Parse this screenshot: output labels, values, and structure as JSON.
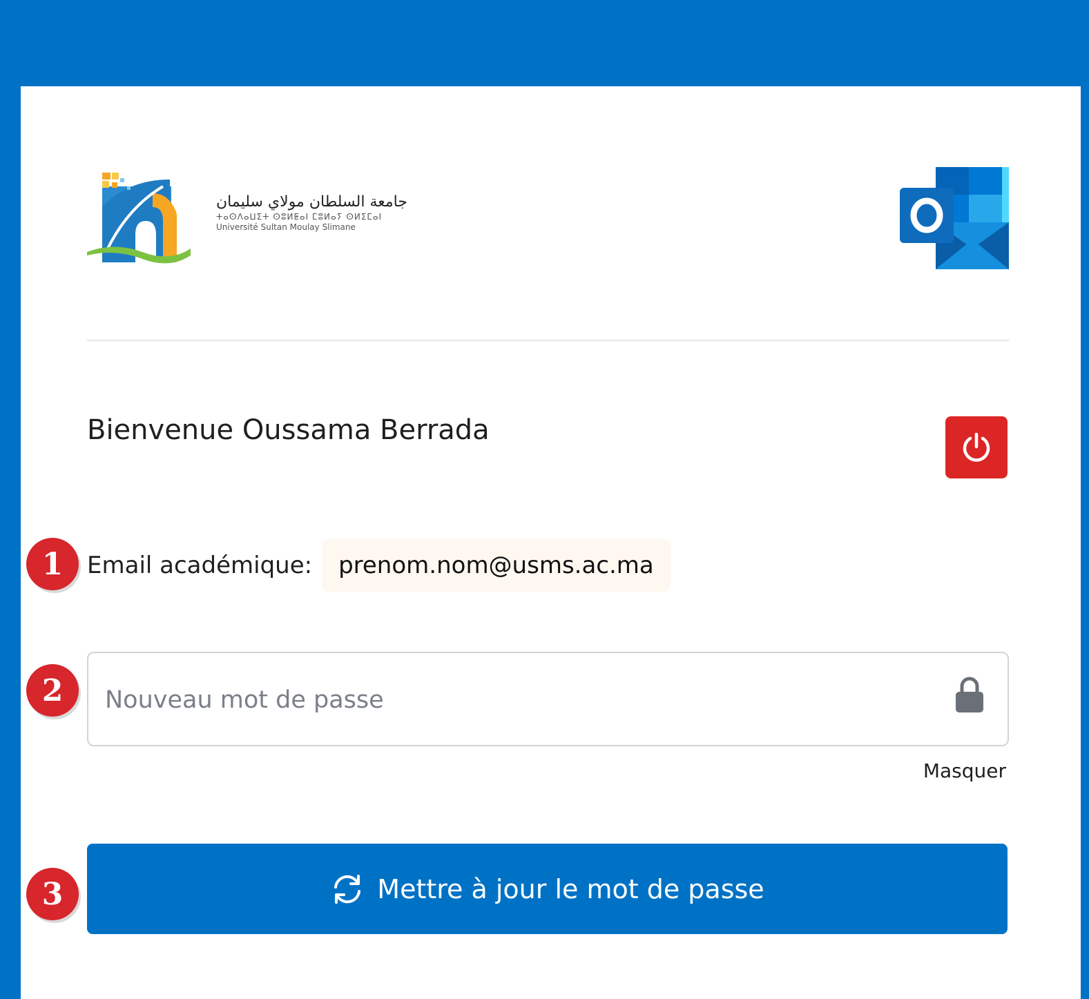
{
  "header": {
    "bg_color": "#0072c6"
  },
  "brand": {
    "arabic_name": "جامعة السلطان مولاي سليمان",
    "tifinagh_name": "ⵜⴰⵙⴷⴰⵡⵉⵜ ⵙⵓⵍⵟⴰⵏ ⵎⵓⵍⴰⵢ ⵙⵍⵉⵎⴰⵏ",
    "french_name": "Université Sultan Moulay Slimane",
    "app_icon": "outlook-icon"
  },
  "welcome": {
    "text": "Bienvenue Oussama Berrada"
  },
  "logout": {
    "icon": "power-icon",
    "color": "#dc2626"
  },
  "steps": [
    "1",
    "2",
    "3"
  ],
  "email": {
    "label": "Email académique:",
    "value": "prenom.nom@usms.ac.ma"
  },
  "password": {
    "placeholder": "Nouveau mot de passe",
    "value": "",
    "icon": "lock-icon",
    "toggle_label": "Masquer"
  },
  "submit": {
    "label": "Mettre à jour le mot de passe",
    "icon": "refresh-icon",
    "color": "#0072c6"
  }
}
